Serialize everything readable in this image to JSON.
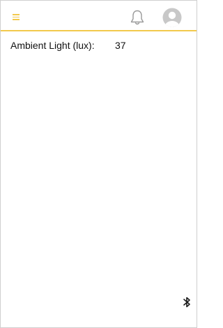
{
  "header": {
    "menu_icon": "hamburger-menu-icon",
    "notification_icon": "bell-icon",
    "profile_icon": "user-avatar-icon",
    "accent_color": "#f2c94c"
  },
  "sensor": {
    "label": "Ambient Light (lux):",
    "value": "37"
  },
  "footer": {
    "bluetooth_icon": "bluetooth-icon"
  }
}
